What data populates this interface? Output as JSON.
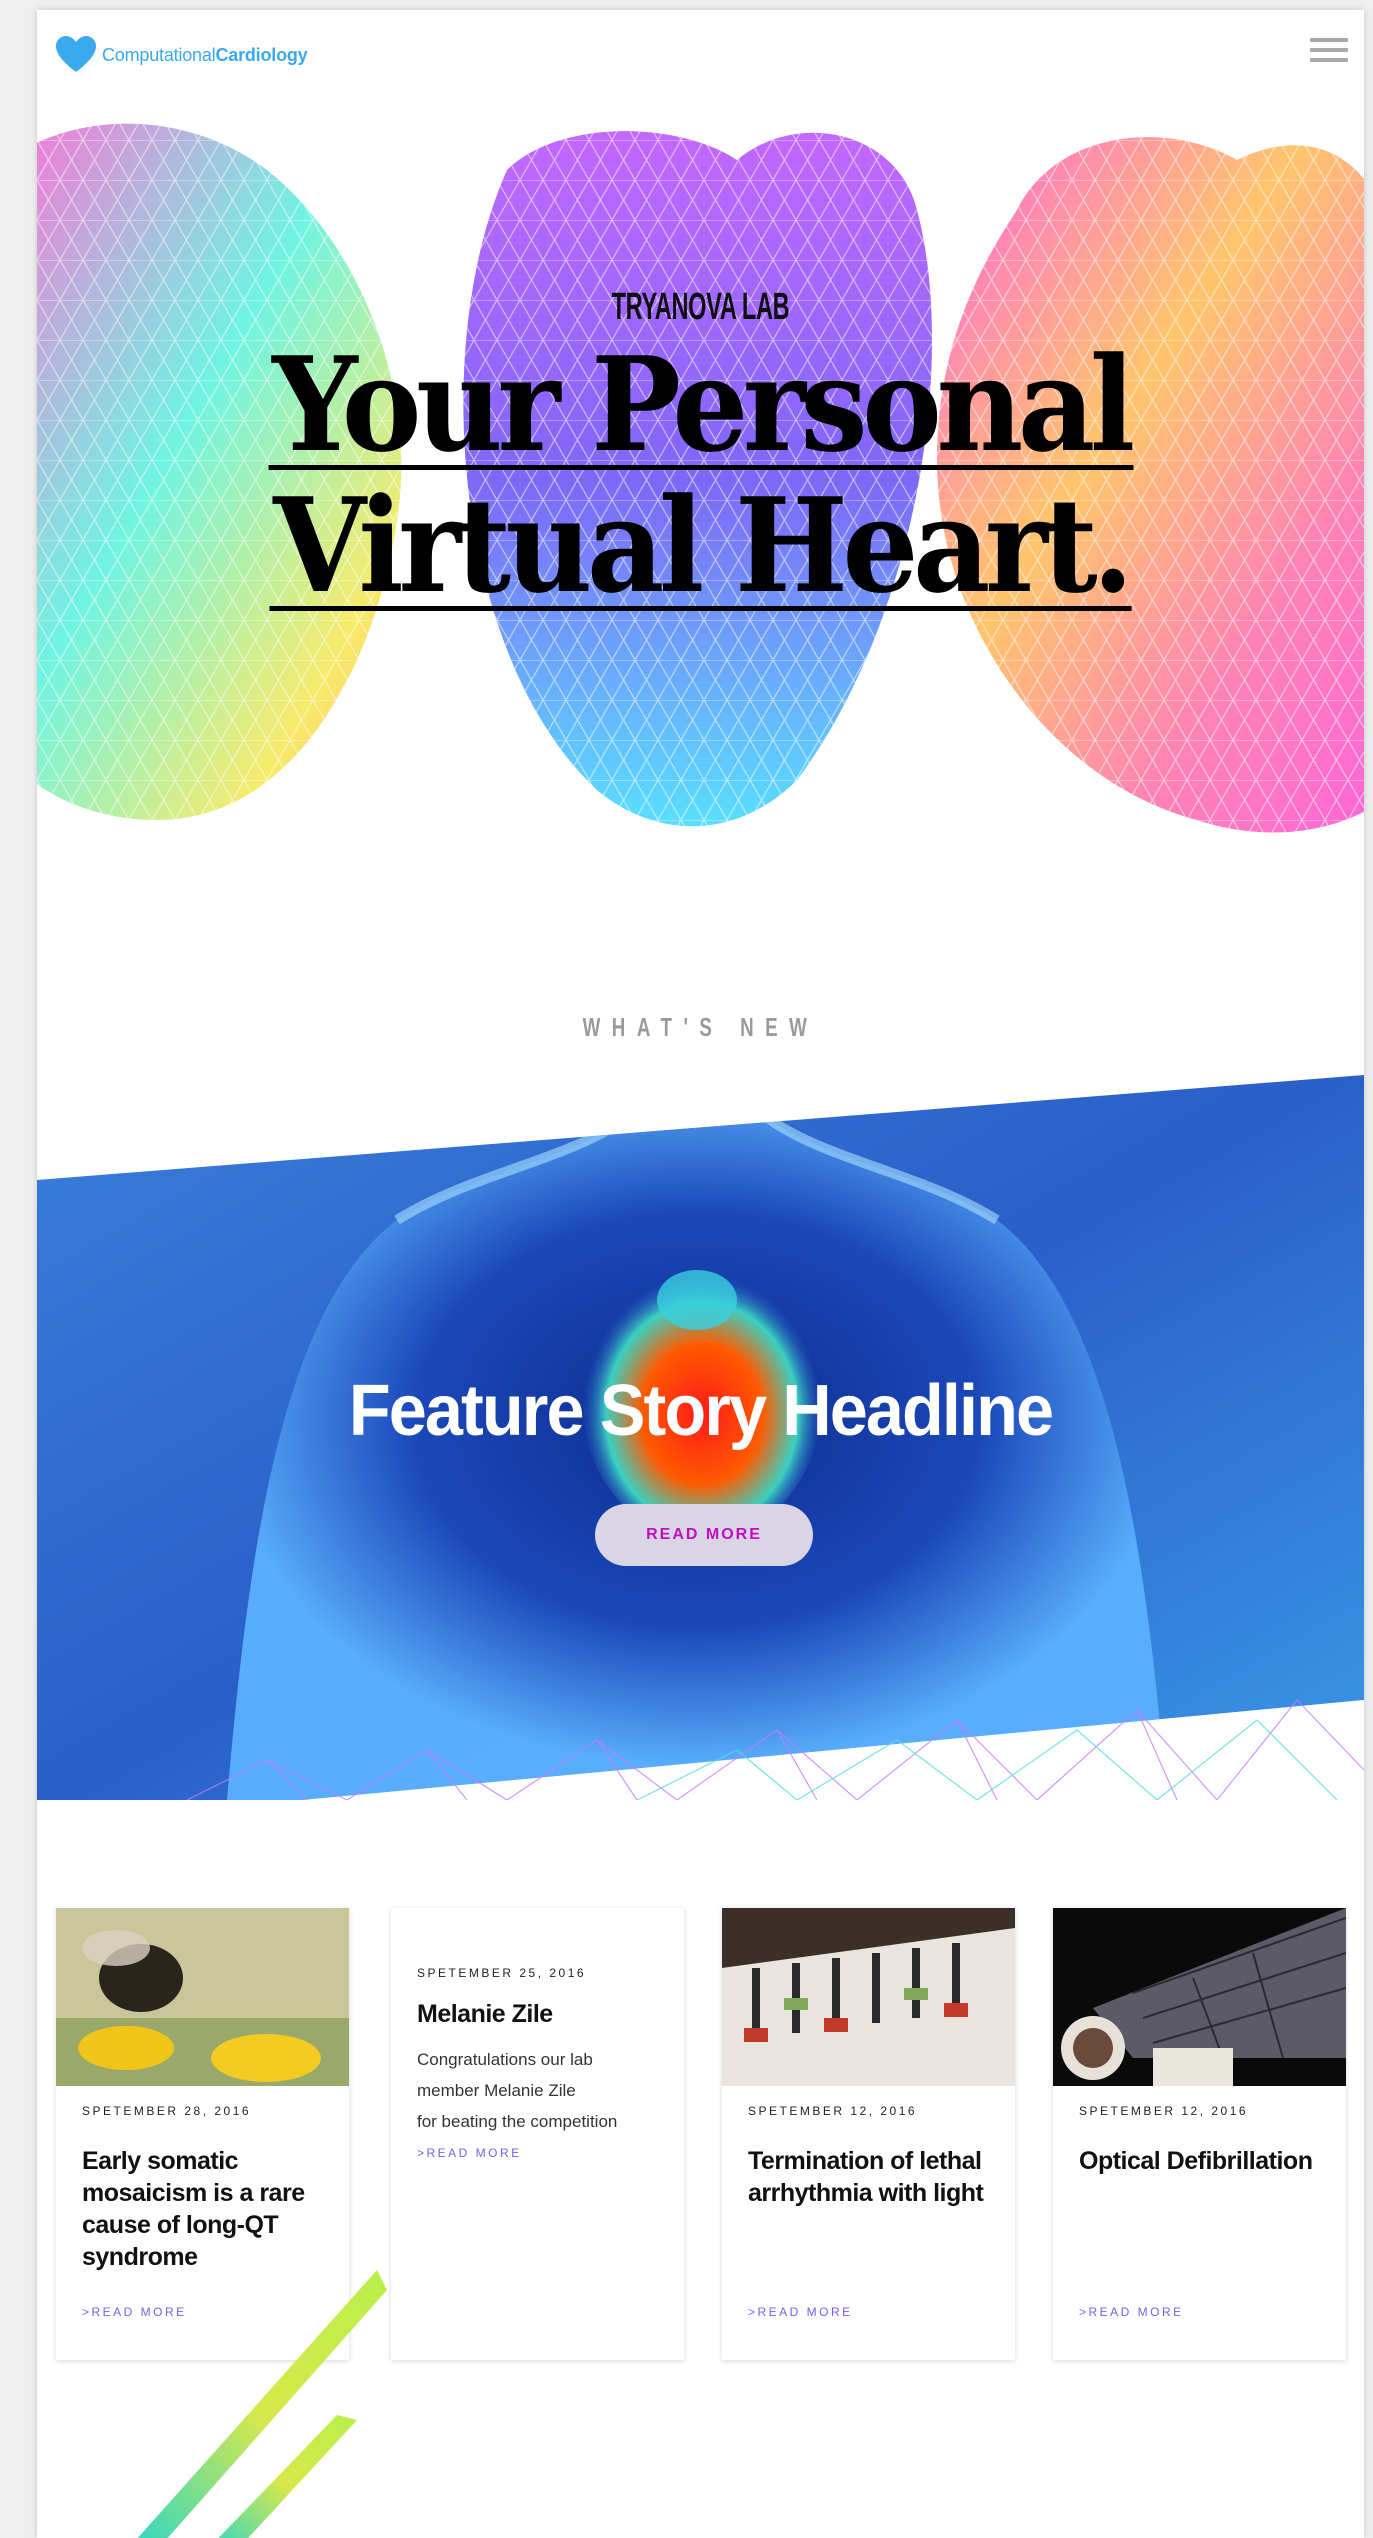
{
  "header": {
    "logo_light": "Computational",
    "logo_bold": "Cardiology",
    "menu_icon": "hamburger-menu-icon"
  },
  "hero": {
    "lab": "TRYANOVA LAB",
    "title_line1": "Your Personal",
    "title_line2": "Virtual Heart."
  },
  "section": {
    "whats_new": "WHAT'S NEW"
  },
  "feature": {
    "headline": "Feature Story Headline",
    "button": "READ MORE"
  },
  "cards": [
    {
      "date": "SPETEMBER 28, 2016",
      "title": "Early somatic mosaicism is a rare cause of long-QT syndrome",
      "link": ">READ MORE",
      "image": "bee-on-flower"
    },
    {
      "date": "SPETEMBER 25, 2016",
      "title": "Melanie Zile",
      "text_line1": "Congratulations our lab",
      "text_line2": "member Melanie Zile",
      "text_line3": "for beating the competition",
      "link": ">READ MORE"
    },
    {
      "date": "SPETEMBER 12, 2016",
      "title": "Termination of lethal arrhythmia with light",
      "link": ">READ MORE",
      "image": "mixing-console"
    },
    {
      "date": "SPETEMBER 12, 2016",
      "title": "Optical Defibrillation",
      "link": ">READ MORE",
      "image": "astronaut-solar-panel"
    }
  ],
  "colors": {
    "brand": "#3aa9ee",
    "link": "#7a5df0",
    "button_text": "#c00fc0",
    "feature_blue": "#2c6fd1"
  }
}
